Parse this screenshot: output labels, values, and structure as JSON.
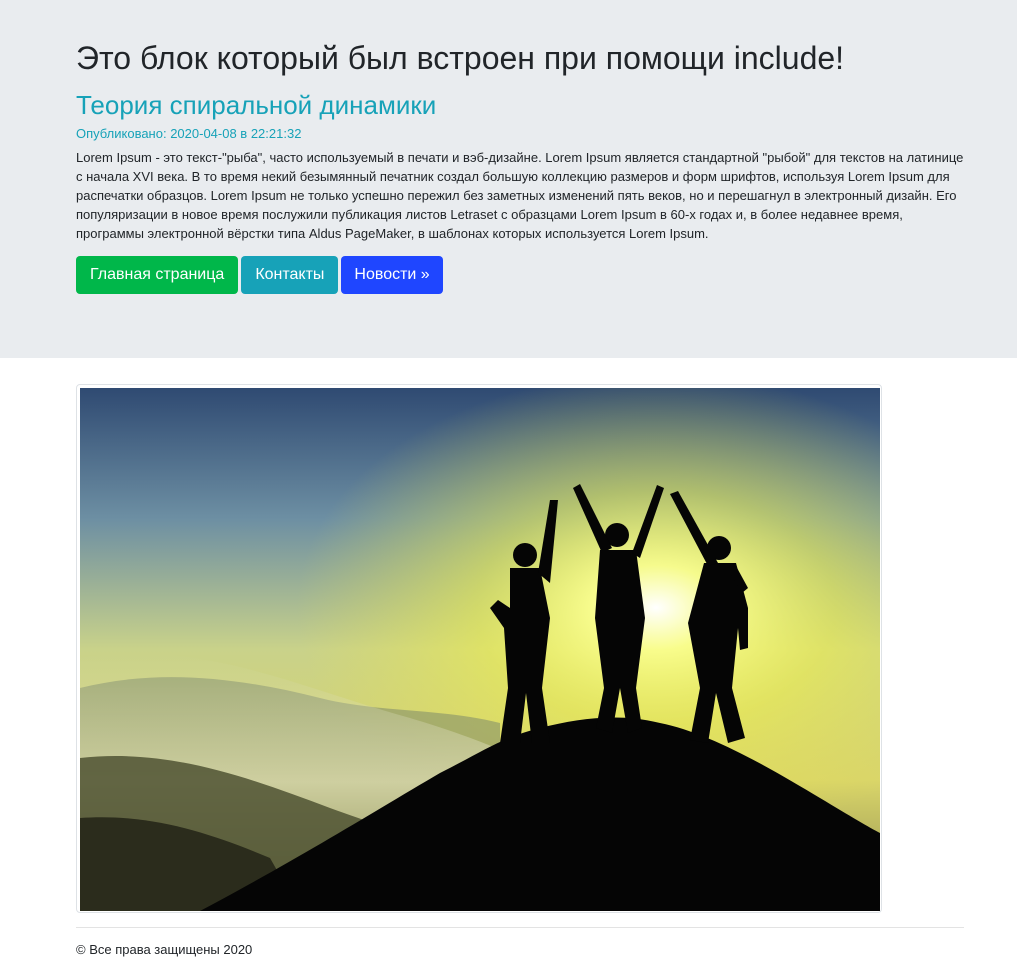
{
  "header": {
    "include_title": "Это блок который был встроен при помощи include!"
  },
  "post": {
    "title": "Теория спиральной динамики",
    "published": "Опубликовано: 2020-04-08 в 22:21:32",
    "body": "Lorem Ipsum - это текст-\"рыба\", часто используемый в печати и вэб-дизайне. Lorem Ipsum является стандартной \"рыбой\" для текстов на латинице с начала XVI века. В то время некий безымянный печатник создал большую коллекцию размеров и форм шрифтов, используя Lorem Ipsum для распечатки образцов. Lorem Ipsum не только успешно пережил без заметных изменений пять веков, но и перешагнул в электронный дизайн. Его популяризации в новое время послужили публикация листов Letraset с образцами Lorem Ipsum в 60-х годах и, в более недавнее время, программы электронной вёрстки типа Aldus PageMaker, в шаблонах которых используется Lorem Ipsum."
  },
  "buttons": {
    "home": "Главная страница",
    "contacts": "Контакты",
    "news": "Новости »"
  },
  "colors": {
    "success": "#00b74a",
    "info": "#17a2b8",
    "primary": "#1f46ff",
    "jumbotron": "#e9ecef"
  },
  "footer": {
    "copyright": "© Все права защищены 2020"
  }
}
